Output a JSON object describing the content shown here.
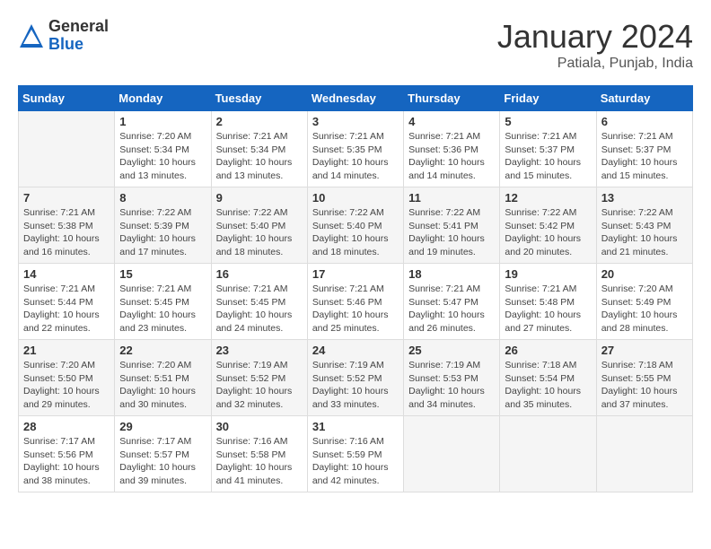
{
  "header": {
    "logo_general": "General",
    "logo_blue": "Blue",
    "title": "January 2024",
    "subtitle": "Patiala, Punjab, India"
  },
  "calendar": {
    "days_of_week": [
      "Sunday",
      "Monday",
      "Tuesday",
      "Wednesday",
      "Thursday",
      "Friday",
      "Saturday"
    ],
    "weeks": [
      [
        {
          "day": "",
          "info": ""
        },
        {
          "day": "1",
          "info": "Sunrise: 7:20 AM\nSunset: 5:34 PM\nDaylight: 10 hours\nand 13 minutes."
        },
        {
          "day": "2",
          "info": "Sunrise: 7:21 AM\nSunset: 5:34 PM\nDaylight: 10 hours\nand 13 minutes."
        },
        {
          "day": "3",
          "info": "Sunrise: 7:21 AM\nSunset: 5:35 PM\nDaylight: 10 hours\nand 14 minutes."
        },
        {
          "day": "4",
          "info": "Sunrise: 7:21 AM\nSunset: 5:36 PM\nDaylight: 10 hours\nand 14 minutes."
        },
        {
          "day": "5",
          "info": "Sunrise: 7:21 AM\nSunset: 5:37 PM\nDaylight: 10 hours\nand 15 minutes."
        },
        {
          "day": "6",
          "info": "Sunrise: 7:21 AM\nSunset: 5:37 PM\nDaylight: 10 hours\nand 15 minutes."
        }
      ],
      [
        {
          "day": "7",
          "info": "Sunrise: 7:21 AM\nSunset: 5:38 PM\nDaylight: 10 hours\nand 16 minutes."
        },
        {
          "day": "8",
          "info": "Sunrise: 7:22 AM\nSunset: 5:39 PM\nDaylight: 10 hours\nand 17 minutes."
        },
        {
          "day": "9",
          "info": "Sunrise: 7:22 AM\nSunset: 5:40 PM\nDaylight: 10 hours\nand 18 minutes."
        },
        {
          "day": "10",
          "info": "Sunrise: 7:22 AM\nSunset: 5:40 PM\nDaylight: 10 hours\nand 18 minutes."
        },
        {
          "day": "11",
          "info": "Sunrise: 7:22 AM\nSunset: 5:41 PM\nDaylight: 10 hours\nand 19 minutes."
        },
        {
          "day": "12",
          "info": "Sunrise: 7:22 AM\nSunset: 5:42 PM\nDaylight: 10 hours\nand 20 minutes."
        },
        {
          "day": "13",
          "info": "Sunrise: 7:22 AM\nSunset: 5:43 PM\nDaylight: 10 hours\nand 21 minutes."
        }
      ],
      [
        {
          "day": "14",
          "info": "Sunrise: 7:21 AM\nSunset: 5:44 PM\nDaylight: 10 hours\nand 22 minutes."
        },
        {
          "day": "15",
          "info": "Sunrise: 7:21 AM\nSunset: 5:45 PM\nDaylight: 10 hours\nand 23 minutes."
        },
        {
          "day": "16",
          "info": "Sunrise: 7:21 AM\nSunset: 5:45 PM\nDaylight: 10 hours\nand 24 minutes."
        },
        {
          "day": "17",
          "info": "Sunrise: 7:21 AM\nSunset: 5:46 PM\nDaylight: 10 hours\nand 25 minutes."
        },
        {
          "day": "18",
          "info": "Sunrise: 7:21 AM\nSunset: 5:47 PM\nDaylight: 10 hours\nand 26 minutes."
        },
        {
          "day": "19",
          "info": "Sunrise: 7:21 AM\nSunset: 5:48 PM\nDaylight: 10 hours\nand 27 minutes."
        },
        {
          "day": "20",
          "info": "Sunrise: 7:20 AM\nSunset: 5:49 PM\nDaylight: 10 hours\nand 28 minutes."
        }
      ],
      [
        {
          "day": "21",
          "info": "Sunrise: 7:20 AM\nSunset: 5:50 PM\nDaylight: 10 hours\nand 29 minutes."
        },
        {
          "day": "22",
          "info": "Sunrise: 7:20 AM\nSunset: 5:51 PM\nDaylight: 10 hours\nand 30 minutes."
        },
        {
          "day": "23",
          "info": "Sunrise: 7:19 AM\nSunset: 5:52 PM\nDaylight: 10 hours\nand 32 minutes."
        },
        {
          "day": "24",
          "info": "Sunrise: 7:19 AM\nSunset: 5:52 PM\nDaylight: 10 hours\nand 33 minutes."
        },
        {
          "day": "25",
          "info": "Sunrise: 7:19 AM\nSunset: 5:53 PM\nDaylight: 10 hours\nand 34 minutes."
        },
        {
          "day": "26",
          "info": "Sunrise: 7:18 AM\nSunset: 5:54 PM\nDaylight: 10 hours\nand 35 minutes."
        },
        {
          "day": "27",
          "info": "Sunrise: 7:18 AM\nSunset: 5:55 PM\nDaylight: 10 hours\nand 37 minutes."
        }
      ],
      [
        {
          "day": "28",
          "info": "Sunrise: 7:17 AM\nSunset: 5:56 PM\nDaylight: 10 hours\nand 38 minutes."
        },
        {
          "day": "29",
          "info": "Sunrise: 7:17 AM\nSunset: 5:57 PM\nDaylight: 10 hours\nand 39 minutes."
        },
        {
          "day": "30",
          "info": "Sunrise: 7:16 AM\nSunset: 5:58 PM\nDaylight: 10 hours\nand 41 minutes."
        },
        {
          "day": "31",
          "info": "Sunrise: 7:16 AM\nSunset: 5:59 PM\nDaylight: 10 hours\nand 42 minutes."
        },
        {
          "day": "",
          "info": ""
        },
        {
          "day": "",
          "info": ""
        },
        {
          "day": "",
          "info": ""
        }
      ]
    ]
  }
}
